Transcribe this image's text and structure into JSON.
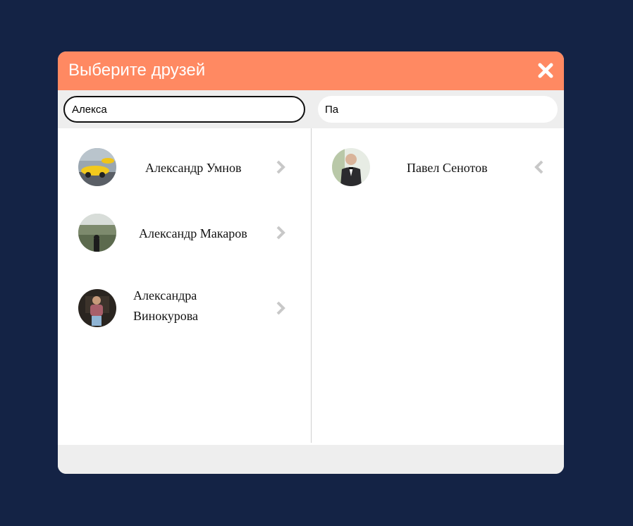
{
  "dialog": {
    "title": "Выберите друзей",
    "close_icon": "close-icon"
  },
  "search": {
    "left_value": "Алекса",
    "right_value": "Па"
  },
  "available_friends": [
    {
      "name": "Александр Умнов",
      "action_icon": "chevron-right-icon"
    },
    {
      "name": "Александр Макаров",
      "action_icon": "chevron-right-icon"
    },
    {
      "name": "Александра Винокурова",
      "action_icon": "chevron-right-icon"
    }
  ],
  "selected_friends": [
    {
      "name": "Павел Сенотов",
      "action_icon": "chevron-left-icon"
    }
  ],
  "colors": {
    "background": "#142345",
    "header": "#ff8962",
    "panel": "#ffffff",
    "footer": "#eeeeee",
    "arrow": "#c8c8c8"
  }
}
